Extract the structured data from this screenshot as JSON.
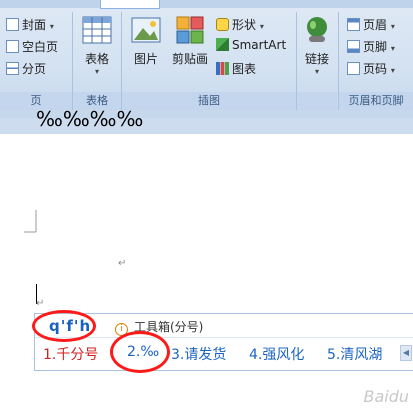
{
  "ribbon": {
    "groups": {
      "pages": {
        "label": "页",
        "items": [
          "封面",
          "空白页",
          "分页"
        ]
      },
      "tables": {
        "label": "表格",
        "button": "表格"
      },
      "illustrations": {
        "label": "插图",
        "picture": "图片",
        "clipart": "剪贴画",
        "shapes": "形状",
        "smartart": "SmartArt",
        "chart": "图表"
      },
      "links": {
        "button": "链接"
      },
      "header_footer": {
        "label": "页眉和页脚",
        "items": [
          "页眉",
          "页脚",
          "页码"
        ]
      }
    }
  },
  "document": {
    "text": "‰‰‰‰",
    "paragraph_mark": "↵"
  },
  "ime": {
    "input": "q'f'h",
    "hint": "工具箱(分号)",
    "candidates": [
      "1.千分号",
      "2.‰",
      "3.请发货",
      "4.强风化",
      "5.清风湖"
    ]
  },
  "watermark": "Baidu"
}
